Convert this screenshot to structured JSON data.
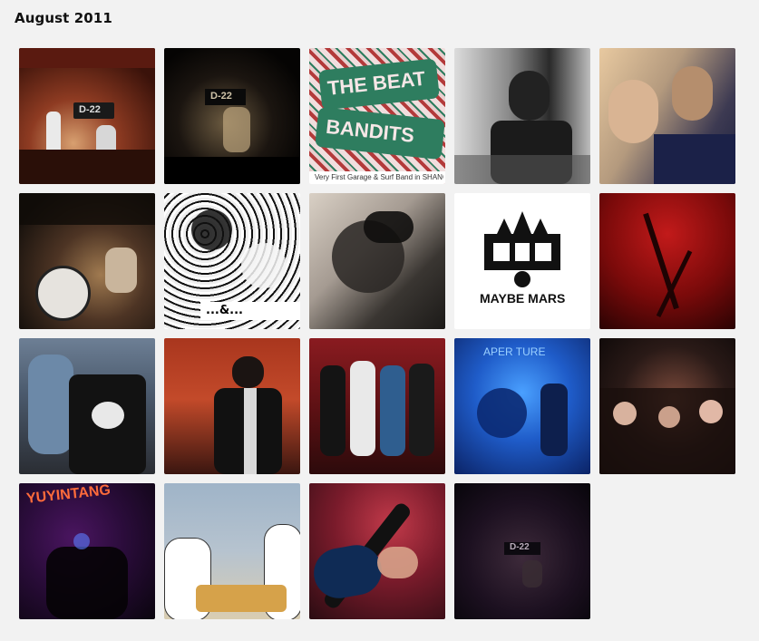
{
  "page": {
    "title": "August 2011"
  },
  "tiles": [
    {
      "id": 1,
      "caption": "D-22"
    },
    {
      "id": 2,
      "caption": "D-22"
    },
    {
      "id": 3,
      "caption_top": "THE BEAT",
      "caption_bottom": "BANDITS",
      "strip": "Very First Garage & Surf Band in SHANGHAI Eve"
    },
    {
      "id": 4
    },
    {
      "id": 5
    },
    {
      "id": 6
    },
    {
      "id": 7,
      "caption": "...&..."
    },
    {
      "id": 8
    },
    {
      "id": 9,
      "caption": "MAYBE MARS"
    },
    {
      "id": 10
    },
    {
      "id": 11
    },
    {
      "id": 12
    },
    {
      "id": 13
    },
    {
      "id": 14,
      "caption": "APER TURE"
    },
    {
      "id": 15
    },
    {
      "id": 16,
      "caption": "YUYINTANG"
    },
    {
      "id": 17
    },
    {
      "id": 18
    },
    {
      "id": 19,
      "caption": "D-22"
    }
  ]
}
